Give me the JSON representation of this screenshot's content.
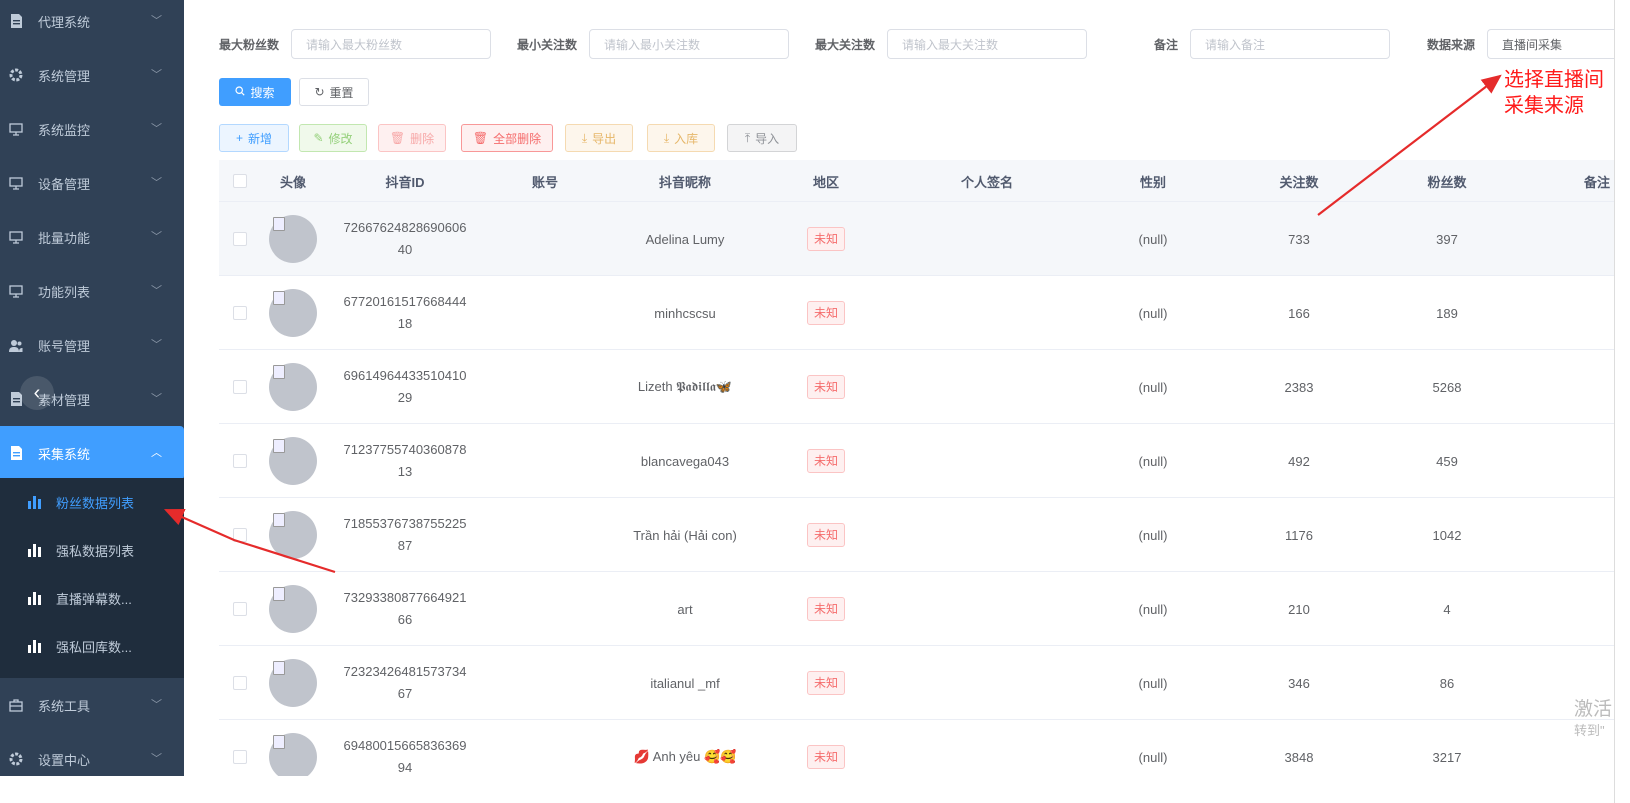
{
  "sidebar": {
    "items": [
      {
        "label": "代理系统",
        "icon": "document-icon"
      },
      {
        "label": "系统管理",
        "icon": "gear-icon"
      },
      {
        "label": "系统监控",
        "icon": "monitor-icon"
      },
      {
        "label": "设备管理",
        "icon": "monitor-icon"
      },
      {
        "label": "批量功能",
        "icon": "monitor-icon"
      },
      {
        "label": "功能列表",
        "icon": "monitor-icon"
      },
      {
        "label": "账号管理",
        "icon": "users-icon"
      },
      {
        "label": "素材管理",
        "icon": "document-icon"
      },
      {
        "label": "采集系统",
        "icon": "document-icon"
      },
      {
        "label": "系统工具",
        "icon": "toolbox-icon"
      },
      {
        "label": "设置中心",
        "icon": "gear-icon"
      }
    ],
    "sub_items": [
      {
        "label": "粉丝数据列表"
      },
      {
        "label": "强私数据列表"
      },
      {
        "label": "直播弹幕数..."
      },
      {
        "label": "强私回库数..."
      }
    ]
  },
  "filters": {
    "max_fans_label": "最大粉丝数",
    "max_fans_placeholder": "请输入最大粉丝数",
    "min_follow_label": "最小关注数",
    "min_follow_placeholder": "请输入最小关注数",
    "max_follow_label": "最大关注数",
    "max_follow_placeholder": "请输入最大关注数",
    "remark_label": "备注",
    "remark_placeholder": "请输入备注",
    "source_label": "数据来源",
    "source_value": "直播间采集"
  },
  "buttons": {
    "search": "搜索",
    "reset": "重置",
    "add": "新增",
    "edit": "修改",
    "delete": "删除",
    "delete_all": "全部删除",
    "export": "导出",
    "store": "入库",
    "import": "导入"
  },
  "table": {
    "headers": [
      "头像",
      "抖音ID",
      "账号",
      "抖音昵称",
      "地区",
      "个人签名",
      "性别",
      "关注数",
      "粉丝数",
      "备注"
    ],
    "rows": [
      {
        "id_line1": "72667624828690606",
        "id_line2": "40",
        "account": "",
        "nickname": "Adelina Lumy",
        "region": "未知",
        "signature": "",
        "gender": "(null)",
        "follows": "733",
        "fans": "397",
        "remark": ""
      },
      {
        "id_line1": "67720161517668444",
        "id_line2": "18",
        "account": "",
        "nickname": "minhcscsu",
        "region": "未知",
        "signature": "",
        "gender": "(null)",
        "follows": "166",
        "fans": "189",
        "remark": ""
      },
      {
        "id_line1": "69614964433510410",
        "id_line2": "29",
        "account": "",
        "nickname": "Lizeth 𝕻𝖆𝖉𝖎𝖑𝖑𝖆🦋",
        "region": "未知",
        "signature": "",
        "gender": "(null)",
        "follows": "2383",
        "fans": "5268",
        "remark": ""
      },
      {
        "id_line1": "71237755740360878",
        "id_line2": "13",
        "account": "",
        "nickname": "blancavega043",
        "region": "未知",
        "signature": "",
        "gender": "(null)",
        "follows": "492",
        "fans": "459",
        "remark": ""
      },
      {
        "id_line1": "71855376738755225",
        "id_line2": "87",
        "account": "",
        "nickname": "Trần hải (Hải con)",
        "region": "未知",
        "signature": "",
        "gender": "(null)",
        "follows": "1176",
        "fans": "1042",
        "remark": ""
      },
      {
        "id_line1": "73293380877664921",
        "id_line2": "66",
        "account": "",
        "nickname": "art",
        "region": "未知",
        "signature": "",
        "gender": "(null)",
        "follows": "210",
        "fans": "4",
        "remark": ""
      },
      {
        "id_line1": "72323426481573734",
        "id_line2": "67",
        "account": "",
        "nickname": "italianul _mf",
        "region": "未知",
        "signature": "",
        "gender": "(null)",
        "follows": "346",
        "fans": "86",
        "remark": ""
      },
      {
        "id_line1": "69480015665836369",
        "id_line2": "94",
        "account": "",
        "nickname": "💋 Anh yêu 🥰🥰",
        "region": "未知",
        "signature": "",
        "gender": "(null)",
        "follows": "3848",
        "fans": "3217",
        "remark": ""
      }
    ]
  },
  "annotation": {
    "line1": "选择直播间",
    "line2": "采集来源"
  },
  "watermark": {
    "line1": "激活",
    "line2": "转到\""
  },
  "colors": {
    "sidebar_bg": "#304156",
    "active": "#409eff",
    "annotation": "#ff1a1a",
    "tag_red": "#f56c6c"
  }
}
